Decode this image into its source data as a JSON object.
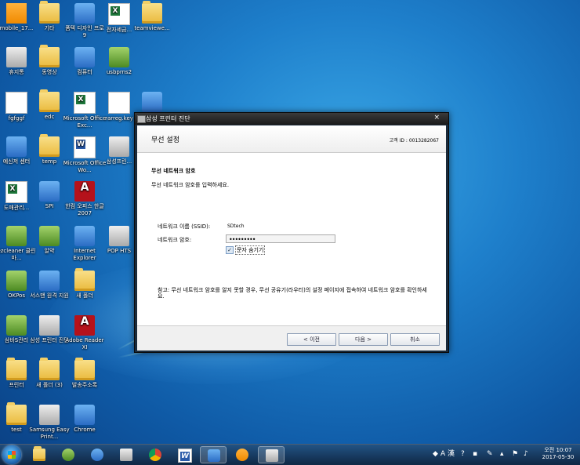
{
  "desktop_icons": [
    {
      "label": "mobile_17...",
      "kind": "orange"
    },
    {
      "label": "기타",
      "kind": "folder"
    },
    {
      "label": "폼텍 디자인 프로 9",
      "kind": "blue"
    },
    {
      "label": "전자세금...",
      "kind": "xls"
    },
    {
      "label": "teamviewe...",
      "kind": "folder"
    },
    {
      "label": "휴지통",
      "kind": "gray"
    },
    {
      "label": "동영상",
      "kind": "folder"
    },
    {
      "label": "컴퓨터",
      "kind": "blue"
    },
    {
      "label": "usbprns2",
      "kind": "green"
    },
    {
      "label": "fgfggf",
      "kind": "doc"
    },
    {
      "label": "edc",
      "kind": "folder"
    },
    {
      "label": "Microsoft Office Exc...",
      "kind": "xls"
    },
    {
      "label": "rarreg.key",
      "kind": "doc"
    },
    {
      "label": "TeamViewer",
      "kind": "blue"
    },
    {
      "label": "예신저 센터",
      "kind": "blue"
    },
    {
      "label": "temp",
      "kind": "folder"
    },
    {
      "label": "Microsoft Office Wo...",
      "kind": "word"
    },
    {
      "label": "삼성프린...",
      "kind": "gray"
    },
    {
      "label": "도매관리...",
      "kind": "xls"
    },
    {
      "label": "SPI",
      "kind": "blue"
    },
    {
      "label": "한컴 오피스 한글 2007",
      "kind": "pdf"
    },
    {
      "label": "ezcleaner 클린마...",
      "kind": "green"
    },
    {
      "label": "알약",
      "kind": "green"
    },
    {
      "label": "Internet Explorer",
      "kind": "blue"
    },
    {
      "label": "POP HTS",
      "kind": "gray"
    },
    {
      "label": "OKPos",
      "kind": "green"
    },
    {
      "label": "서스맨 원격 지원",
      "kind": "blue"
    },
    {
      "label": "새 폴더",
      "kind": "folder"
    },
    {
      "label": "삼바S관리",
      "kind": "green"
    },
    {
      "label": "삼성 프린터 진단",
      "kind": "gray"
    },
    {
      "label": "Adobe Reader XI",
      "kind": "pdf"
    },
    {
      "label": "프린터",
      "kind": "folder"
    },
    {
      "label": "새 폴더 (3)",
      "kind": "folder"
    },
    {
      "label": "발송주소록",
      "kind": "folder"
    },
    {
      "label": "test",
      "kind": "folder"
    },
    {
      "label": "Samsung Easy Print...",
      "kind": "gray"
    },
    {
      "label": "Chrome",
      "kind": "blue"
    }
  ],
  "dialog": {
    "title": "삼성 프린터 진단",
    "close": "×",
    "header_title": "무선 설정",
    "customer_id": "고객 ID : 0013282067",
    "section_title": "무선 네트워크 암호",
    "section_desc": "무선 네트워크 암호를 입력하세요.",
    "ssid_label": "네트워크 이름 (SSID):",
    "ssid_value": "SDtech",
    "password_label": "네트워크 암호:",
    "password_value": "•••••••••",
    "hide_chars_checked": true,
    "hide_chars_label": "문자 숨기기",
    "note": "참고: 무선 네트워크 암호를 알지 못할 경우, 무선 공유기(라우터)의 설정 페이지에 접속하여 네트워크 암호를 확인하세요.",
    "buttons": {
      "back": "< 이전",
      "next": "다음 >",
      "cancel": "취소"
    }
  },
  "taskbar": {
    "ime_mode": "A",
    "ime_hanja": "漢",
    "clock_time": "오전 10:07",
    "clock_date": "2017-05-30"
  }
}
